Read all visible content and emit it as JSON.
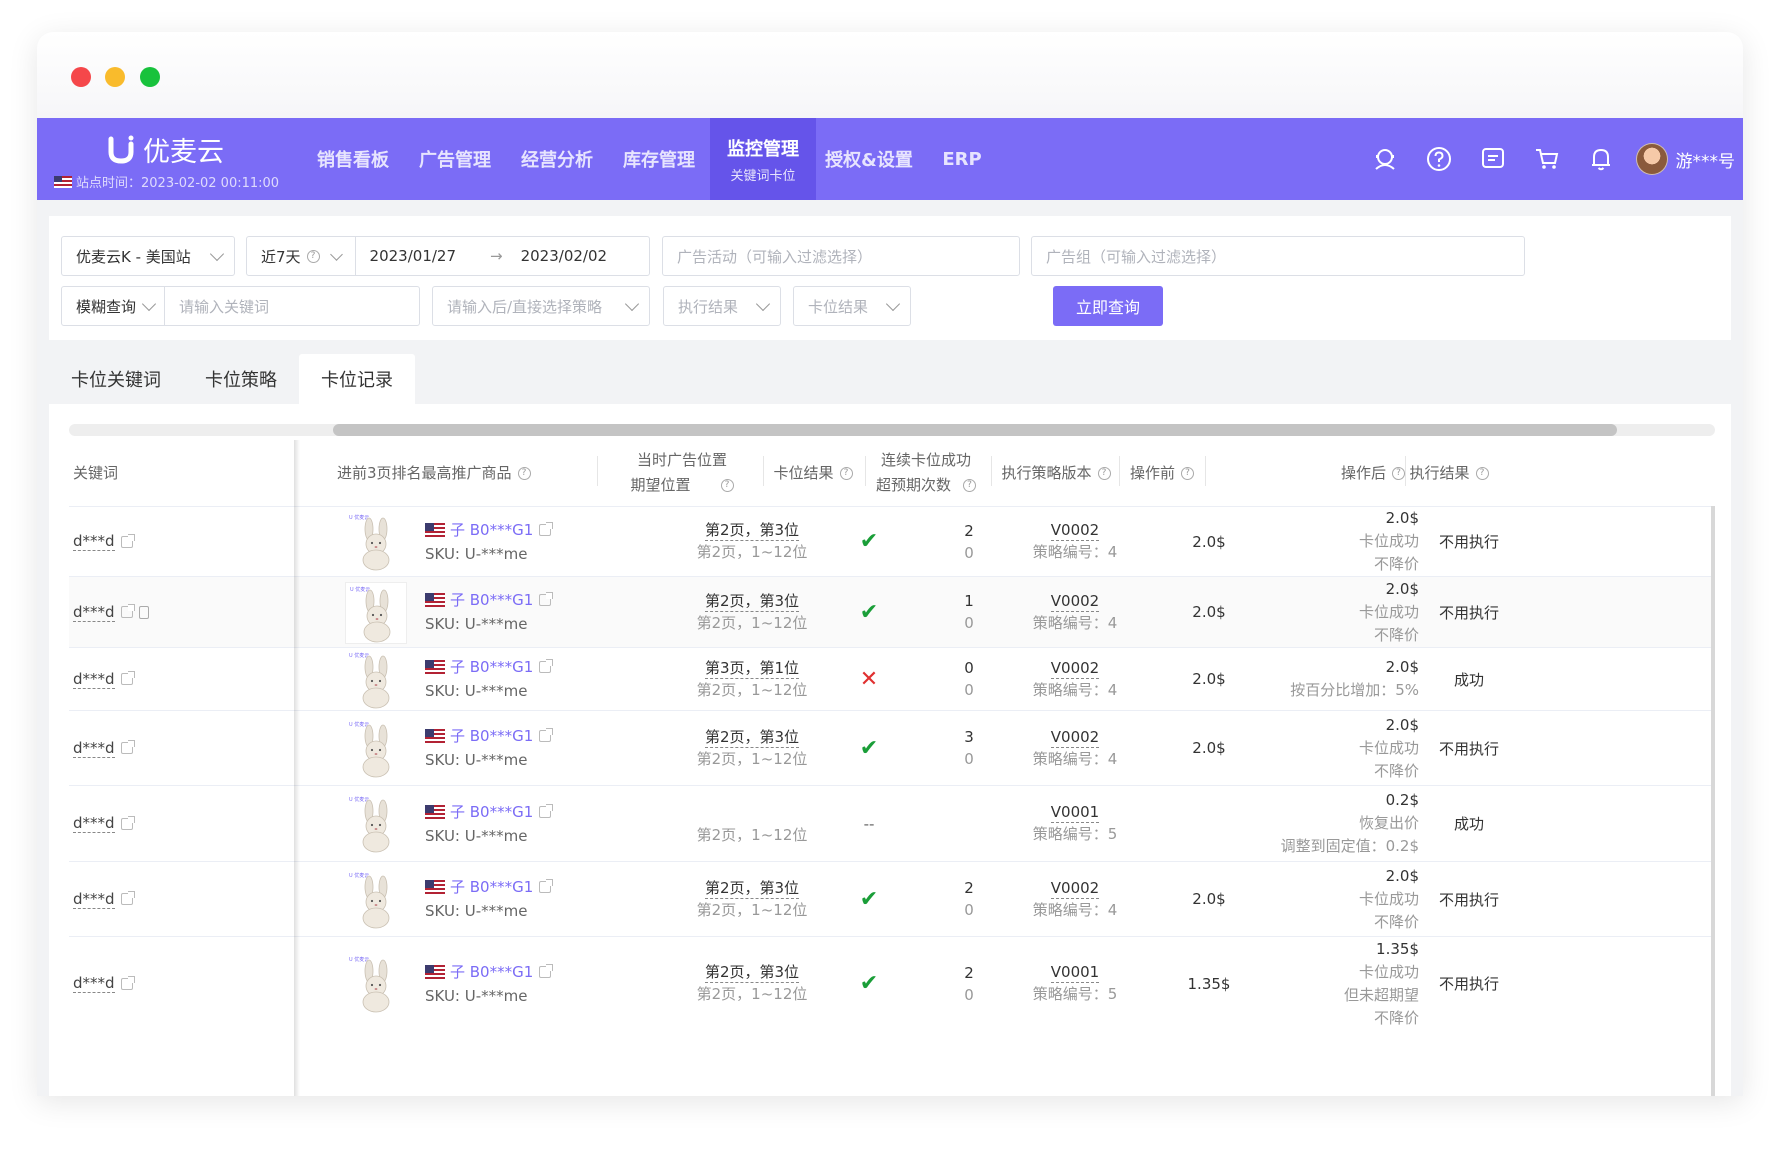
{
  "nav": {
    "brand": "优麦云",
    "station_time": "站点时间：2023-02-02 00:11:00",
    "items": [
      {
        "label": "销售看板"
      },
      {
        "label": "广告管理"
      },
      {
        "label": "经营分析"
      },
      {
        "label": "库存管理"
      },
      {
        "label": "监控管理",
        "sub": "关键词卡位",
        "active": true
      },
      {
        "label": "授权&设置"
      },
      {
        "label": "ERP"
      }
    ],
    "icons": [
      "user-service-icon",
      "help-icon",
      "message-icon",
      "cart-icon",
      "bell-icon"
    ],
    "username": "游***号"
  },
  "filters": {
    "shop": "优麦云K - 美国站",
    "period": "近7天",
    "date_start": "2023/01/27",
    "date_end": "2023/02/02",
    "campaign_placeholder": "广告活动（可输入过滤选择）",
    "adgroup_placeholder": "广告组（可输入过滤选择）",
    "match_mode": "模糊查询",
    "keyword_placeholder": "请输入关键词",
    "strategy_placeholder": "请输入后/直接选择策略",
    "exec_result_placeholder": "执行结果",
    "rank_result_placeholder": "卡位结果",
    "search_button": "立即查询"
  },
  "tabs": [
    {
      "label": "卡位关键词"
    },
    {
      "label": "卡位策略"
    },
    {
      "label": "卡位记录",
      "active": true
    }
  ],
  "table": {
    "headers": {
      "keyword": "关键词",
      "product": "进前3页排名最高推广商品",
      "position_1": "当时广告位置",
      "position_2": "期望位置",
      "result": "卡位结果",
      "streak_1": "连续卡位成功",
      "streak_2": "超预期次数",
      "version": "执行策略版本",
      "before": "操作前",
      "after": "操作后",
      "exec": "执行结果"
    },
    "rows": [
      {
        "keyword": "d***d",
        "copy": false,
        "asin": "子 B0***G1",
        "sku": "SKU: U-***me",
        "pos_current": "第2页，第3位",
        "pos_expected": "第2页，1~12位",
        "result": "ok",
        "streak": "2",
        "exceed": "0",
        "version": "V0002",
        "strategy_no": "策略编号：4",
        "before": "2.0$",
        "after_price": "2.0$",
        "after_lines": [
          "卡位成功",
          "不降价"
        ],
        "exec": "不用执行"
      },
      {
        "keyword": "d***d",
        "copy": true,
        "asin": "子 B0***G1",
        "sku": "SKU: U-***me",
        "pos_current": "第2页，第3位",
        "pos_expected": "第2页，1~12位",
        "result": "ok",
        "streak": "1",
        "exceed": "0",
        "version": "V0002",
        "strategy_no": "策略编号：4",
        "before": "2.0$",
        "after_price": "2.0$",
        "after_lines": [
          "卡位成功",
          "不降价"
        ],
        "exec": "不用执行"
      },
      {
        "keyword": "d***d",
        "copy": false,
        "asin": "子 B0***G1",
        "sku": "SKU: U-***me",
        "pos_current": "第3页，第1位",
        "pos_expected": "第2页，1~12位",
        "result": "fail",
        "streak": "0",
        "exceed": "0",
        "version": "V0002",
        "strategy_no": "策略编号：4",
        "before": "2.0$",
        "after_price": "2.0$",
        "after_lines": [
          "按百分比增加：5%"
        ],
        "exec": "成功"
      },
      {
        "keyword": "d***d",
        "copy": false,
        "asin": "子 B0***G1",
        "sku": "SKU: U-***me",
        "pos_current": "第2页，第3位",
        "pos_expected": "第2页，1~12位",
        "result": "ok",
        "streak": "3",
        "exceed": "0",
        "version": "V0002",
        "strategy_no": "策略编号：4",
        "before": "2.0$",
        "after_price": "2.0$",
        "after_lines": [
          "卡位成功",
          "不降价"
        ],
        "exec": "不用执行"
      },
      {
        "keyword": "d***d",
        "copy": false,
        "asin": "子 B0***G1",
        "sku": "SKU: U-***me",
        "pos_current": "",
        "pos_expected": "第2页，1~12位",
        "result": "none",
        "result_text": "--",
        "streak": "",
        "exceed": "",
        "version": "V0001",
        "strategy_no": "策略编号：5",
        "before": "",
        "after_price": "0.2$",
        "after_lines": [
          "恢复出价",
          "调整到固定值：0.2$"
        ],
        "exec": "成功"
      },
      {
        "keyword": "d***d",
        "copy": false,
        "asin": "子 B0***G1",
        "sku": "SKU: U-***me",
        "pos_current": "第2页，第3位",
        "pos_expected": "第2页，1~12位",
        "result": "ok",
        "streak": "2",
        "exceed": "0",
        "version": "V0002",
        "strategy_no": "策略编号：4",
        "before": "2.0$",
        "after_price": "2.0$",
        "after_lines": [
          "卡位成功",
          "不降价"
        ],
        "exec": "不用执行"
      },
      {
        "keyword": "d***d",
        "copy": false,
        "asin": "子 B0***G1",
        "sku": "SKU: U-***me",
        "pos_current": "第2页，第3位",
        "pos_expected": "第2页，1~12位",
        "result": "ok",
        "streak": "2",
        "exceed": "0",
        "version": "V0001",
        "strategy_no": "策略编号：5",
        "before": "1.35$",
        "after_price": "1.35$",
        "after_lines": [
          "卡位成功",
          "但未超期望",
          "不降价"
        ],
        "exec": "不用执行"
      }
    ]
  },
  "colors": {
    "brand": "#7b6cf6",
    "success": "#1a9e38",
    "fail": "#e03030"
  }
}
